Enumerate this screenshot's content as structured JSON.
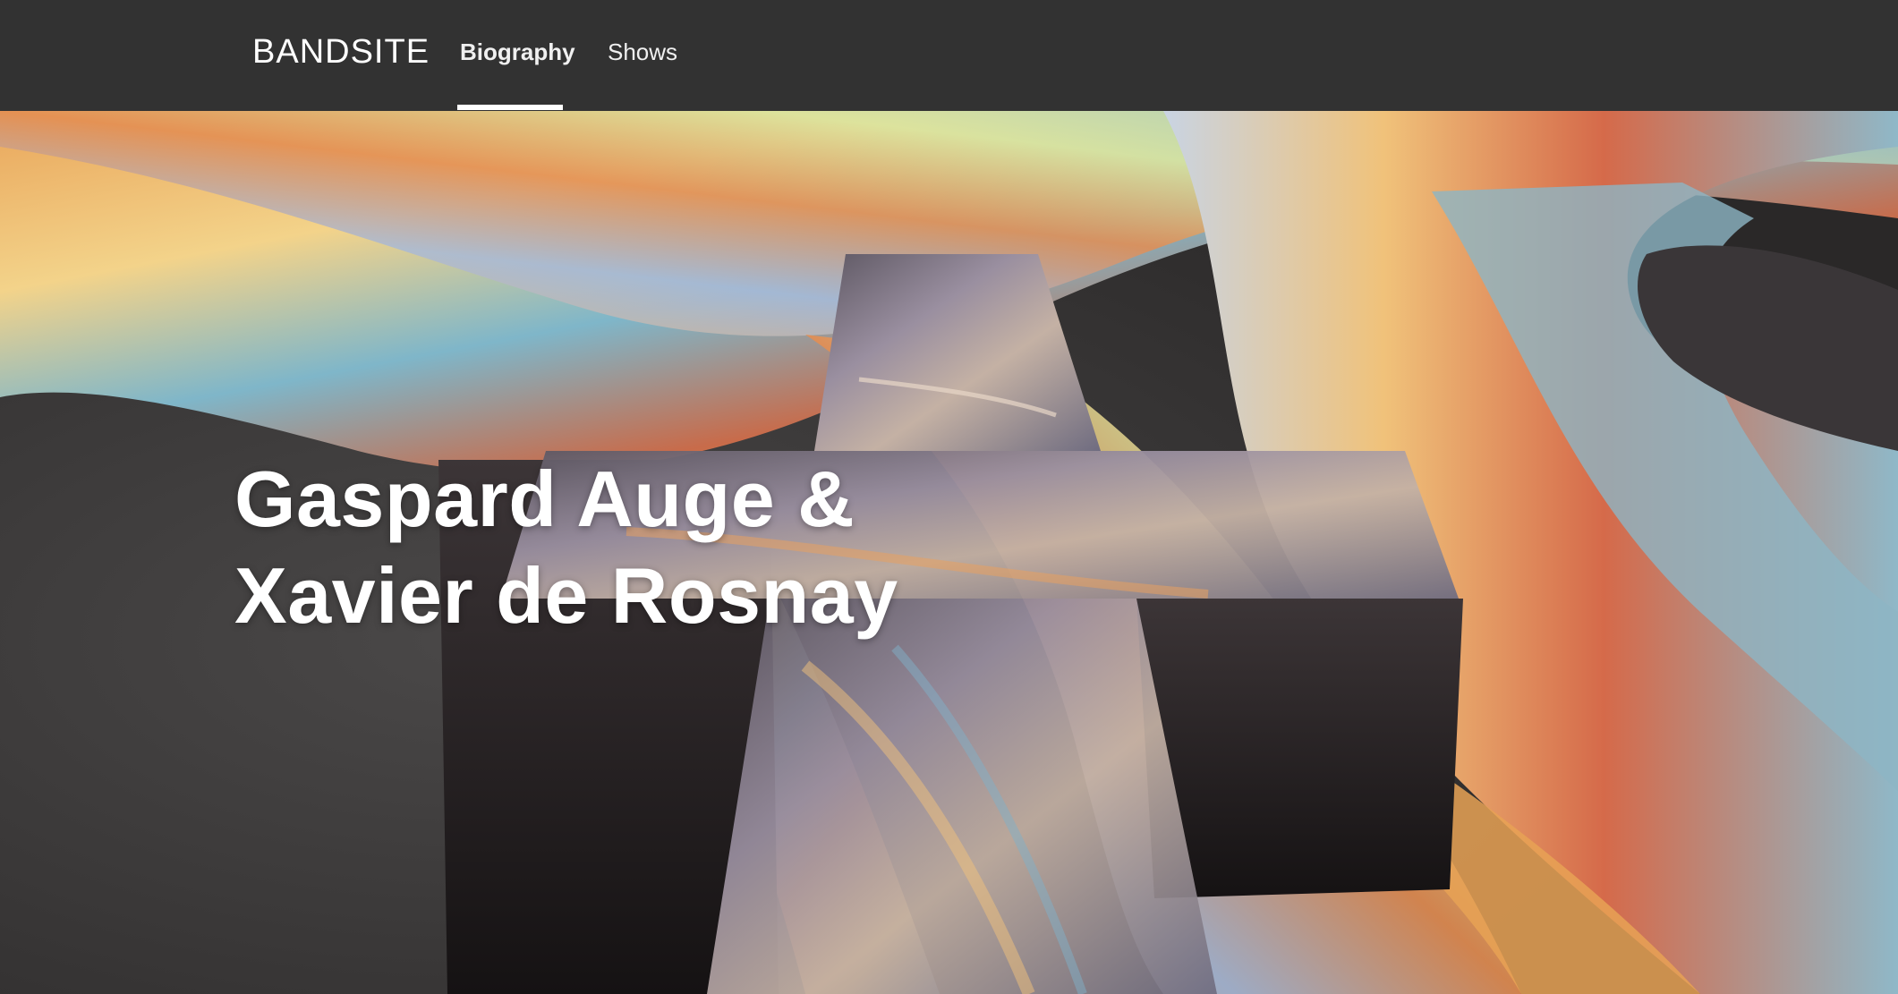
{
  "header": {
    "logo": "BANDSITE",
    "nav": [
      {
        "label": "Biography",
        "active": true
      },
      {
        "label": "Shows",
        "active": false
      }
    ]
  },
  "hero": {
    "title_line1": "Gaspard Auge &",
    "title_line2": "Xavier de Rosnay",
    "image_icon": "iridescent-cross-artwork"
  },
  "colors": {
    "header_bg": "#323232",
    "text": "#ffffff",
    "active_underline": "#ffffff"
  }
}
